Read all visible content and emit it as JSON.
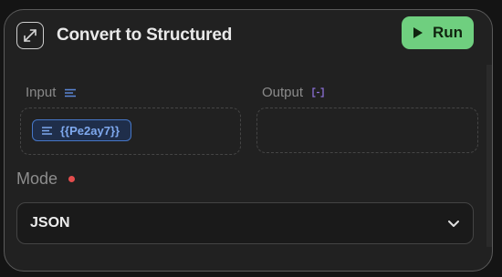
{
  "node": {
    "title": "Convert to Structured",
    "icon": "expand-arrows-icon",
    "run_label": "Run",
    "run_color": "#6fcf7f"
  },
  "input": {
    "label": "Input",
    "icon": "text-lines-icon",
    "chip_text": "{{Pe2ay7}}",
    "chip_icon": "text-lines-icon"
  },
  "output": {
    "label": "Output",
    "icon": "structured-braces-icon"
  },
  "mode": {
    "label": "Mode",
    "required": true,
    "value": "JSON"
  }
}
